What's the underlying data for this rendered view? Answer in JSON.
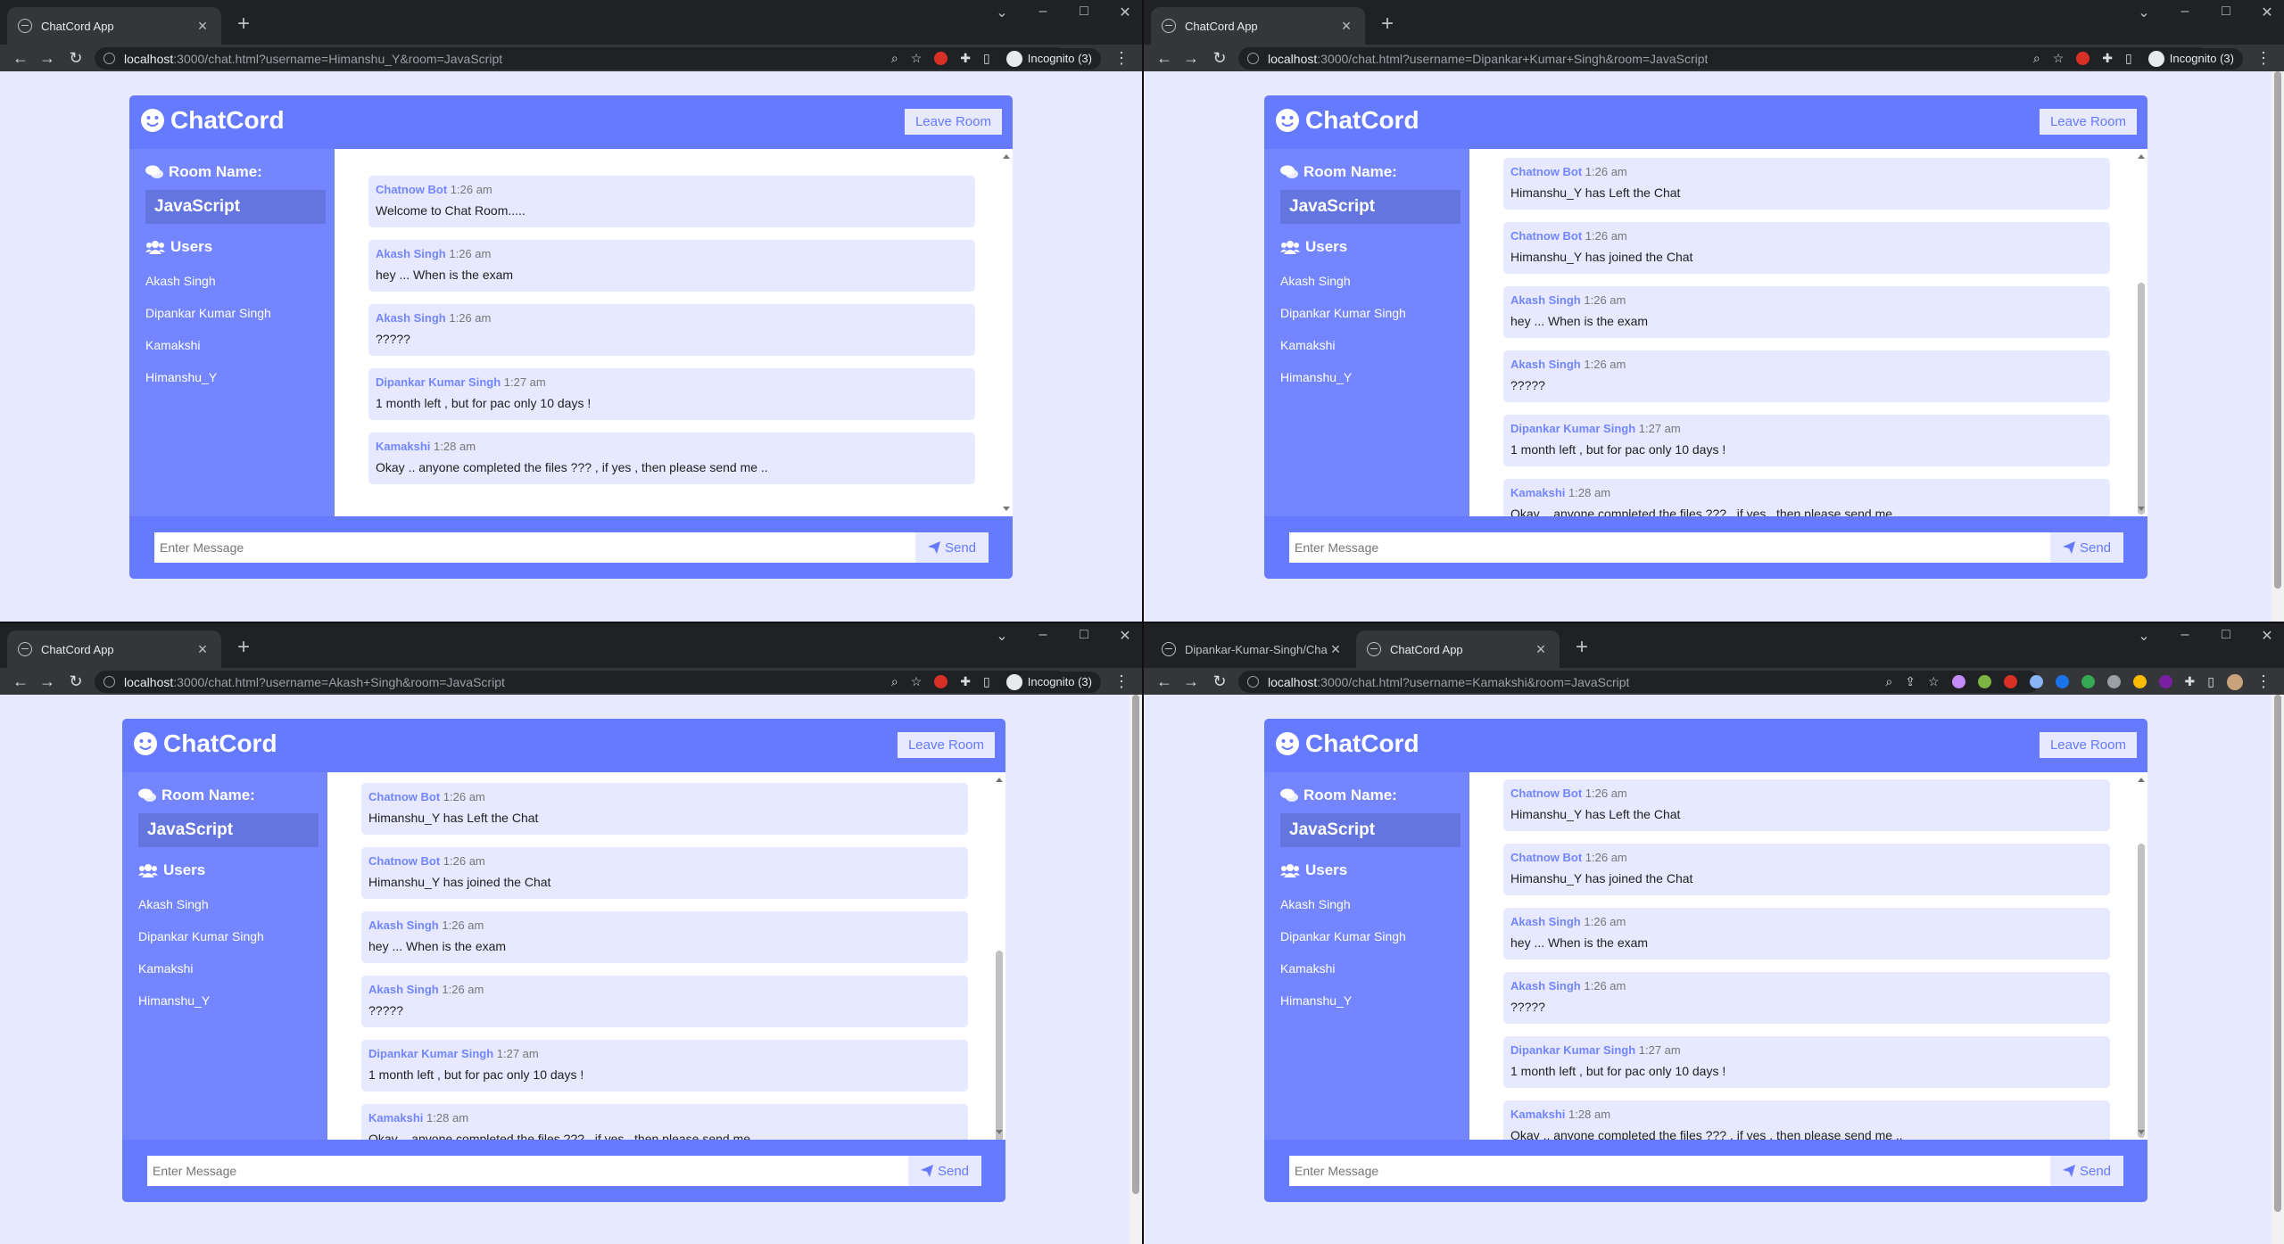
{
  "colors": {
    "primary": "#667aff",
    "secondary": "#7386ff",
    "light": "#e6e9ff"
  },
  "chatcord": {
    "brand": "ChatCord",
    "leave_label": "Leave Room",
    "room_heading": "Room Name:",
    "room_name": "JavaScript",
    "users_heading": "Users",
    "users": [
      "Akash Singh",
      "Dipankar Kumar Singh",
      "Kamakshi",
      "Himanshu_Y"
    ],
    "input_placeholder": "Enter Message",
    "send_label": "Send"
  },
  "windows": [
    {
      "tabs": [
        {
          "title": "ChatCord App",
          "active": true
        }
      ],
      "url_host": "localhost",
      "url_path": ":3000/chat.html?username=Himanshu_Y&room=JavaScript",
      "incognito_label": "Incognito (3)",
      "messages": [
        {
          "user": "Chatnow Bot",
          "time": "1:26 am",
          "text": "Welcome to Chat Room....."
        },
        {
          "user": "Akash Singh",
          "time": "1:26 am",
          "text": "hey ... When is the exam"
        },
        {
          "user": "Akash Singh",
          "time": "1:26 am",
          "text": "?????"
        },
        {
          "user": "Dipankar Kumar Singh",
          "time": "1:27 am",
          "text": "1 month left , but for pac only 10 days !"
        },
        {
          "user": "Kamakshi",
          "time": "1:28 am",
          "text": "Okay .. anyone completed the files ??? , if yes , then please send me .."
        }
      ]
    },
    {
      "tabs": [
        {
          "title": "ChatCord App",
          "active": true
        }
      ],
      "url_host": "localhost",
      "url_path": ":3000/chat.html?username=Dipankar+Kumar+Singh&room=JavaScript",
      "incognito_label": "Incognito (3)",
      "messages": [
        {
          "user": "Chatnow Bot",
          "time": "1:26 am",
          "text": "Himanshu_Y has Left the Chat"
        },
        {
          "user": "Chatnow Bot",
          "time": "1:26 am",
          "text": "Himanshu_Y has joined the Chat"
        },
        {
          "user": "Akash Singh",
          "time": "1:26 am",
          "text": "hey ... When is the exam"
        },
        {
          "user": "Akash Singh",
          "time": "1:26 am",
          "text": "?????"
        },
        {
          "user": "Dipankar Kumar Singh",
          "time": "1:27 am",
          "text": "1 month left , but for pac only 10 days !"
        },
        {
          "user": "Kamakshi",
          "time": "1:28 am",
          "text": "Okay .. anyone completed the files ??? , if yes , then please send me .."
        }
      ]
    },
    {
      "tabs": [
        {
          "title": "ChatCord App",
          "active": true
        }
      ],
      "url_host": "localhost",
      "url_path": ":3000/chat.html?username=Akash+Singh&room=JavaScript",
      "incognito_label": "Incognito (3)",
      "messages": [
        {
          "user": "Chatnow Bot",
          "time": "1:26 am",
          "text": "Himanshu_Y has Left the Chat"
        },
        {
          "user": "Chatnow Bot",
          "time": "1:26 am",
          "text": "Himanshu_Y has joined the Chat"
        },
        {
          "user": "Akash Singh",
          "time": "1:26 am",
          "text": "hey ... When is the exam"
        },
        {
          "user": "Akash Singh",
          "time": "1:26 am",
          "text": "?????"
        },
        {
          "user": "Dipankar Kumar Singh",
          "time": "1:27 am",
          "text": "1 month left , but for pac only 10 days !"
        },
        {
          "user": "Kamakshi",
          "time": "1:28 am",
          "text": "Okay .. anyone completed the files ??? , if yes , then please send me .."
        }
      ]
    },
    {
      "tabs": [
        {
          "title": "Dipankar-Kumar-Singh/Chatnow",
          "active": false
        },
        {
          "title": "ChatCord App",
          "active": true
        }
      ],
      "url_host": "localhost",
      "url_path": ":3000/chat.html?username=Kamakshi&room=JavaScript",
      "incognito_label": "",
      "messages": [
        {
          "user": "Chatnow Bot",
          "time": "1:26 am",
          "text": "Himanshu_Y has Left the Chat"
        },
        {
          "user": "Chatnow Bot",
          "time": "1:26 am",
          "text": "Himanshu_Y has joined the Chat"
        },
        {
          "user": "Akash Singh",
          "time": "1:26 am",
          "text": "hey ... When is the exam"
        },
        {
          "user": "Akash Singh",
          "time": "1:26 am",
          "text": "?????"
        },
        {
          "user": "Dipankar Kumar Singh",
          "time": "1:27 am",
          "text": "1 month left , but for pac only 10 days !"
        },
        {
          "user": "Kamakshi",
          "time": "1:28 am",
          "text": "Okay .. anyone completed the files ??? , if yes , then please send me .."
        }
      ]
    }
  ]
}
